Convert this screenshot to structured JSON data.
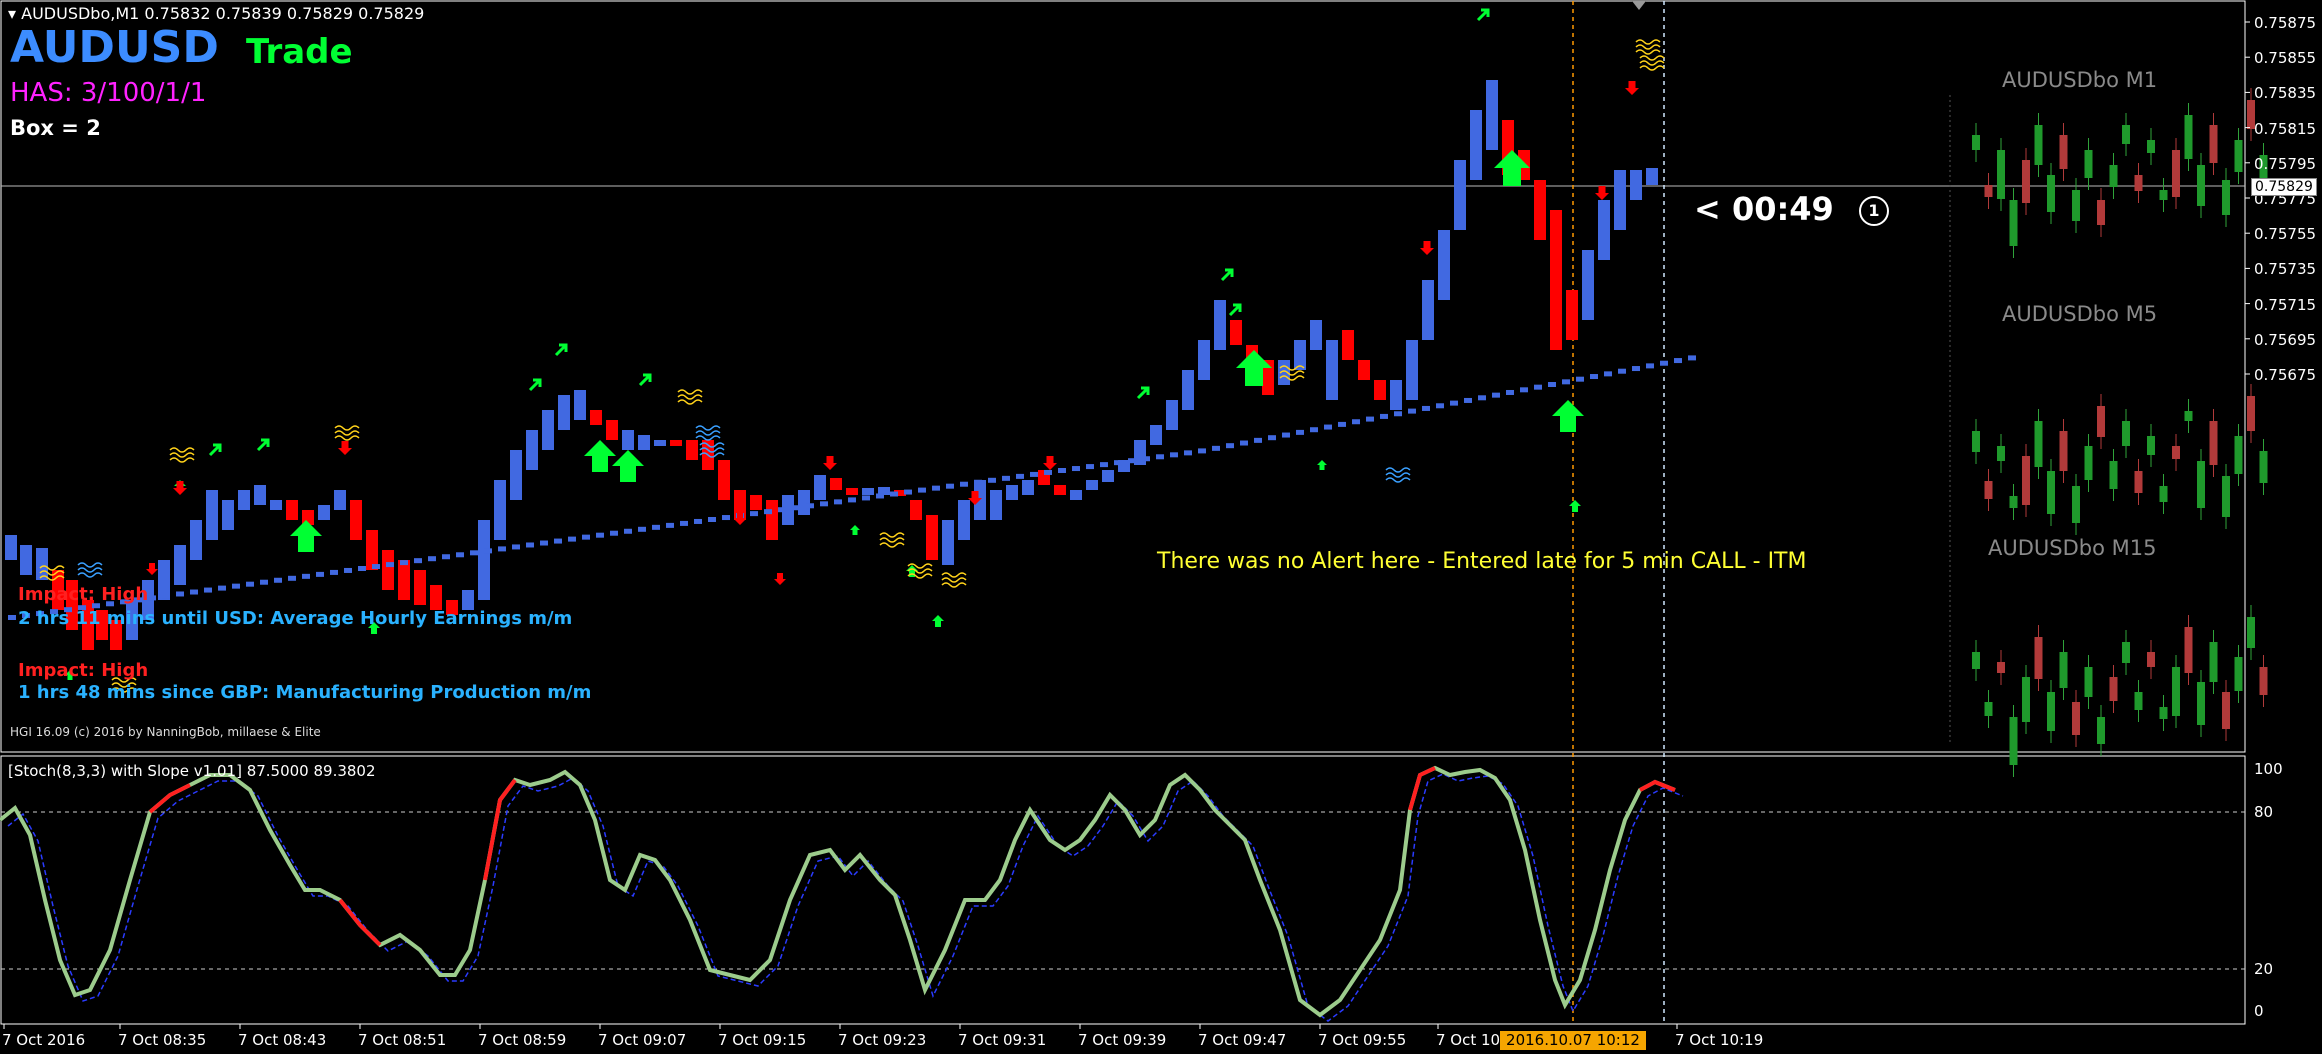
{
  "header": {
    "symbol_line": "AUDUSDbo,M1  0.75832 0.75839 0.75829 0.75829",
    "symbol": "AUDUSD",
    "mode": "Trade",
    "has": "HAS: 3/100/1/1",
    "box": "Box = 2"
  },
  "news": [
    {
      "impact": "Impact: High",
      "text": "2 hrs 11 mins until USD: Average Hourly Earnings m/m"
    },
    {
      "impact": "Impact: High",
      "text": "1 hrs 48 mins since GBP: Manufacturing Production m/m"
    }
  ],
  "credit": "HGI 16.09 (c) 2016 by NanningBob, millaese & Elite",
  "timer": "< 00:49",
  "timer_icon": "clock-icon",
  "annotation": "There was no Alert here - Entered late for 5 min CALL - ITM",
  "current_price": "0.75829",
  "price_axis": [
    "0.75875",
    "0.75855",
    "0.75835",
    "0.75815",
    "0.75795",
    "0.75775",
    "0.75755",
    "0.75735",
    "0.75715",
    "0.75695",
    "0.75675"
  ],
  "mini_charts": [
    {
      "title": "AUDUSDbo M1"
    },
    {
      "title": "AUDUSDbo M5"
    },
    {
      "title": "AUDUSDbo M15"
    }
  ],
  "stochastic": {
    "label": "[Stoch(8,3,3) with Slope v1.01] 87.5000 89.3802",
    "levels": [
      "100",
      "80",
      "20",
      "0"
    ]
  },
  "time_axis": [
    "7 Oct 2016",
    "7 Oct 08:35",
    "7 Oct 08:43",
    "7 Oct 08:51",
    "7 Oct 08:59",
    "7 Oct 09:07",
    "7 Oct 09:15",
    "7 Oct 09:23",
    "7 Oct 09:31",
    "7 Oct 09:39",
    "7 Oct 09:47",
    "7 Oct 09:55",
    "7 Oct 10",
    "7 Oct 10:19"
  ],
  "time_highlight": "2016.10.07 10:12",
  "colors": {
    "up_bar": "#4169e1",
    "down_bar": "#ff0000",
    "grid": "#ffffff",
    "arrow_up": "#00ff33",
    "arrow_down": "#ff0000",
    "stoch_main": "#9ccc8c",
    "stoch_signal": "#2a3bff",
    "cursor": "#ff9900"
  }
}
